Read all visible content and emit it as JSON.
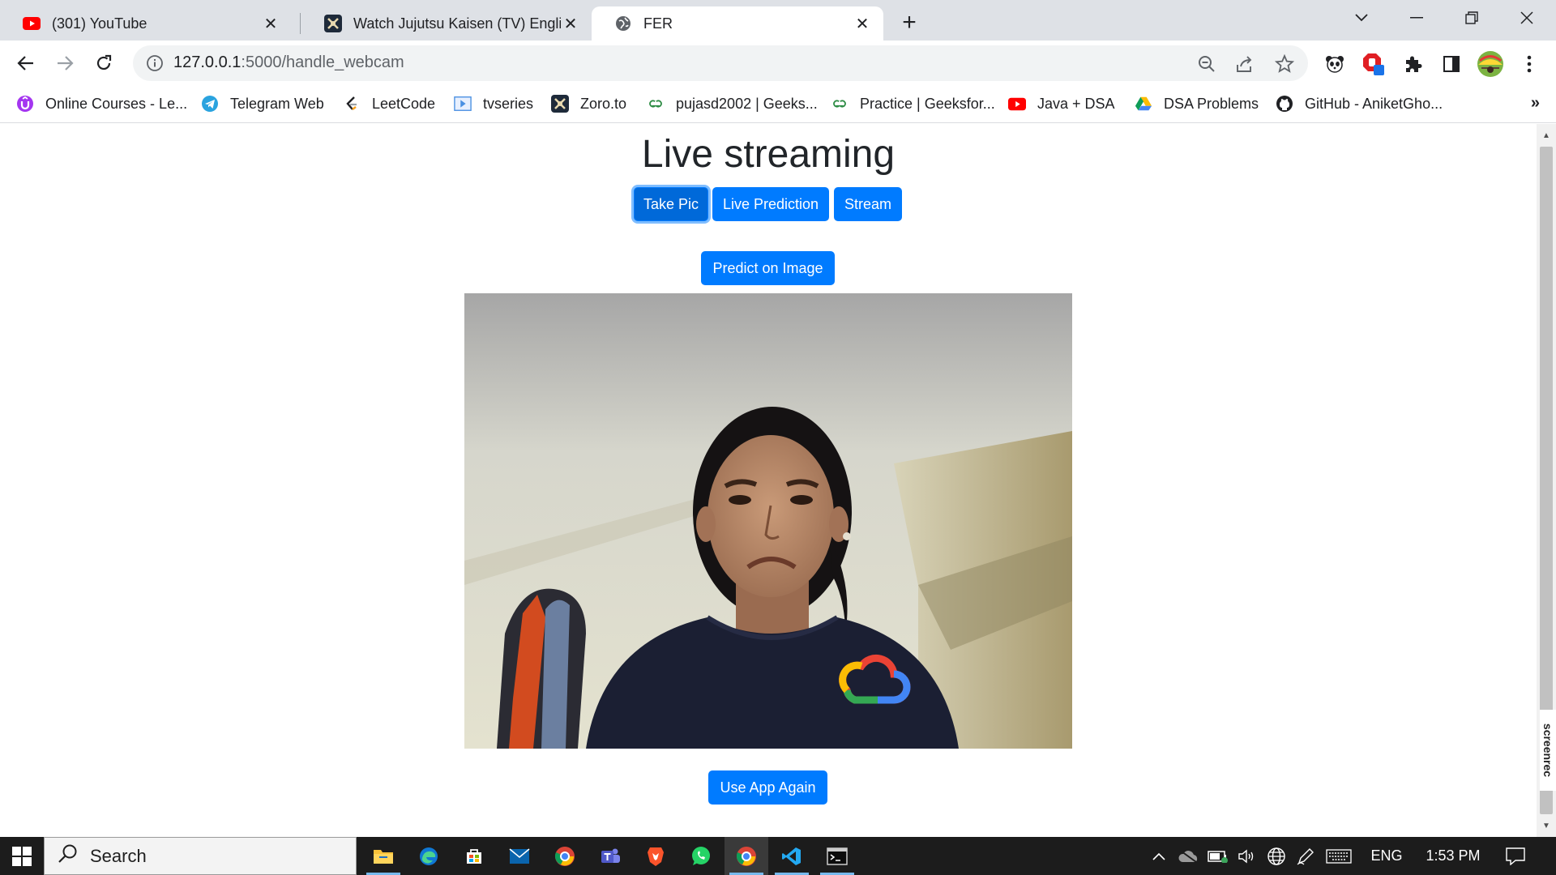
{
  "tabs": [
    {
      "title": "(301) YouTube",
      "icon": "youtube-icon"
    },
    {
      "title": "Watch Jujutsu Kaisen (TV) English",
      "icon": "zoro-icon"
    },
    {
      "title": "FER",
      "icon": "globe-icon",
      "active": true
    }
  ],
  "omnibox": {
    "host": "127.0.0.1",
    "path": ":5000/handle_webcam"
  },
  "bookmarks": [
    {
      "label": "Online Courses - Le...",
      "icon": "udemy-icon"
    },
    {
      "label": "Telegram Web",
      "icon": "telegram-icon"
    },
    {
      "label": "LeetCode",
      "icon": "leetcode-icon"
    },
    {
      "label": "tvseries",
      "icon": "video-icon"
    },
    {
      "label": "Zoro.to",
      "icon": "zoro-icon"
    },
    {
      "label": "pujasd2002 | Geeks...",
      "icon": "geeksforgeeks-icon"
    },
    {
      "label": "Practice | Geeksfor...",
      "icon": "geeksforgeeks-icon"
    },
    {
      "label": "Java + DSA",
      "icon": "youtube-icon"
    },
    {
      "label": "DSA Problems",
      "icon": "google-drive-icon"
    },
    {
      "label": "GitHub - AniketGho...",
      "icon": "github-icon"
    }
  ],
  "page": {
    "title": "Live streaming",
    "buttons": {
      "take_pic": "Take Pic",
      "live_prediction": "Live Prediction",
      "stream": "Stream",
      "predict_on_image": "Predict on Image",
      "use_app_again": "Use App Again"
    }
  },
  "taskbar": {
    "search_label": "Search",
    "language": "ENG",
    "time": "1:53 PM"
  },
  "screenrec_label": "screenrec",
  "colors": {
    "primary_button": "#007bff",
    "tab_strip": "#dee1e6",
    "taskbar": "#1c1c1c"
  }
}
